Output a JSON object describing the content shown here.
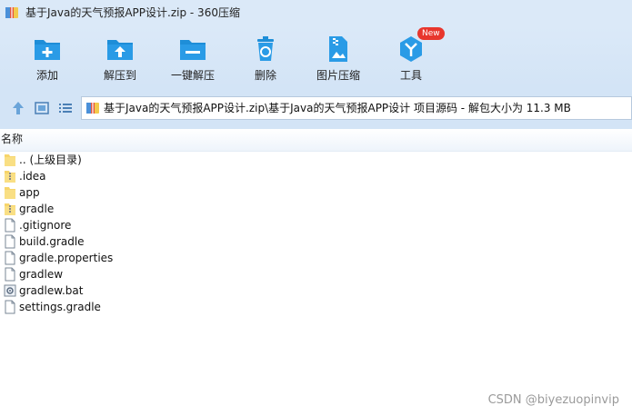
{
  "window": {
    "title": "基于Java的天气预报APP设计.zip - 360压缩"
  },
  "toolbar": {
    "items": [
      {
        "label": "添加",
        "icon": "add-icon"
      },
      {
        "label": "解压到",
        "icon": "extract-to-icon"
      },
      {
        "label": "一键解压",
        "icon": "one-click-extract-icon"
      },
      {
        "label": "删除",
        "icon": "delete-icon"
      },
      {
        "label": "图片压缩",
        "icon": "image-compress-icon"
      },
      {
        "label": "工具",
        "icon": "tools-icon",
        "badge": "New"
      }
    ]
  },
  "address": {
    "path": "基于Java的天气预报APP设计.zip\\基于Java的天气预报APP设计 项目源码 - 解包大小为 11.3 MB"
  },
  "list": {
    "column_name": "名称",
    "rows": [
      {
        "name": ".. (上级目录)",
        "type": "folder"
      },
      {
        "name": ".idea",
        "type": "folder-zip"
      },
      {
        "name": "app",
        "type": "folder"
      },
      {
        "name": "gradle",
        "type": "folder-zip"
      },
      {
        "name": ".gitignore",
        "type": "file"
      },
      {
        "name": "build.gradle",
        "type": "file"
      },
      {
        "name": "gradle.properties",
        "type": "file"
      },
      {
        "name": "gradlew",
        "type": "file"
      },
      {
        "name": "gradlew.bat",
        "type": "bat"
      },
      {
        "name": "settings.gradle",
        "type": "file"
      }
    ]
  },
  "watermark": "CSDN @biyezuopinvip",
  "colors": {
    "accent": "#1e8ed8",
    "titlebar": "#dbe9f8",
    "folder": "#f7d56b",
    "badge": "#e8362d"
  }
}
